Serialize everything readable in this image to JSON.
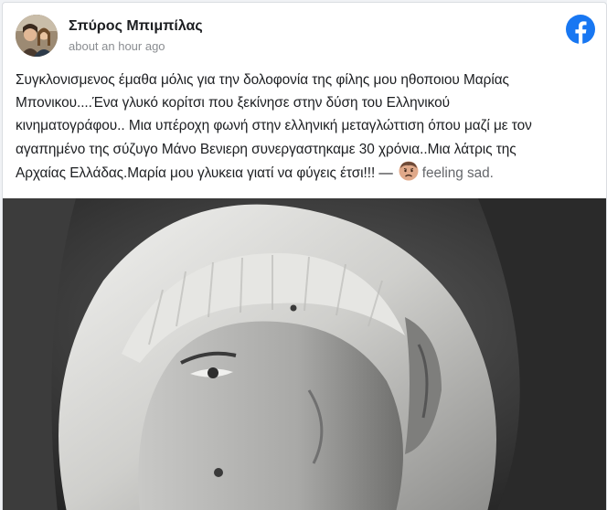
{
  "post": {
    "author": "Σπύρος Μπιμπίλας",
    "timestamp": "about an hour ago",
    "text_lines": [
      "Συγκλονισμενος έμαθα μόλις για την δολοφονία της φίλης μου ηθοποιου Μαρίας",
      "Μπονικου....Ένα γλυκό κορίτσι που ξεκίνησε στην δύση του Ελληνικού",
      "κινηματογράφου.. Μια υπέροχη φωνή στην ελληνική μεταγλώττιση όπου μαζί με τον",
      "αγαπημένο της σύζυγο Μάνο Βενιερη συνεργαστηκαμε 30 χρόνια..Μια λάτρις της",
      "Αρχαίας Ελλάδας.Μαρία μου γλυκεια γιατί να φύγεις έτσι!!! —"
    ],
    "feeling_text": "feeling sad."
  },
  "icons": {
    "brand": "facebook-logo-icon",
    "feeling": "sad-face-emoji-icon"
  },
  "colors": {
    "facebook_blue": "#1877f2",
    "text": "#1c1e21",
    "secondary_text": "#8a8d91"
  }
}
